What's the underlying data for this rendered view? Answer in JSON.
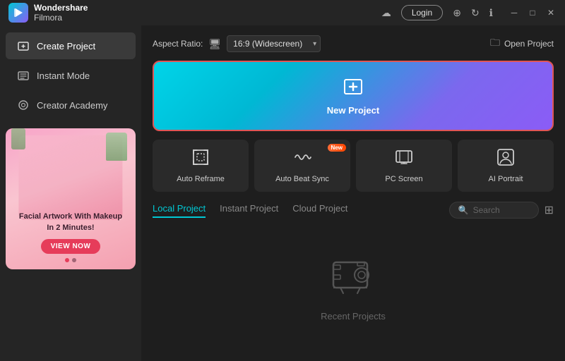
{
  "titlebar": {
    "brand": "Wondershare",
    "app": "Filmora",
    "login_label": "Login"
  },
  "sidebar": {
    "items": [
      {
        "id": "create-project",
        "label": "Create Project",
        "icon": "⊞",
        "active": true
      },
      {
        "id": "instant-mode",
        "label": "Instant Mode",
        "icon": "⚡",
        "active": false
      },
      {
        "id": "creator-academy",
        "label": "Creator Academy",
        "icon": "◎",
        "active": false
      }
    ],
    "ad": {
      "text": "Facial Artwork With Makeup\nIn 2 Minutes!",
      "button_label": "VIEW NOW"
    }
  },
  "topbar": {
    "aspect_ratio_label": "Aspect Ratio:",
    "aspect_value": "16:9 (Widescreen)",
    "open_project_label": "Open Project"
  },
  "new_project": {
    "label": "New Project"
  },
  "features": [
    {
      "id": "auto-reframe",
      "label": "Auto Reframe",
      "icon": "⛶",
      "badge": ""
    },
    {
      "id": "auto-beat-sync",
      "label": "Auto Beat Sync",
      "icon": "〜",
      "badge": "New"
    },
    {
      "id": "pc-screen",
      "label": "PC Screen",
      "icon": "▣",
      "badge": ""
    },
    {
      "id": "ai-portrait",
      "label": "AI Portrait",
      "icon": "⊡",
      "badge": ""
    }
  ],
  "projects": {
    "tabs": [
      {
        "id": "local",
        "label": "Local Project",
        "active": true
      },
      {
        "id": "instant",
        "label": "Instant Project",
        "active": false
      },
      {
        "id": "cloud",
        "label": "Cloud Project",
        "active": false
      }
    ],
    "search_placeholder": "Search",
    "empty_label": "Recent Projects"
  }
}
